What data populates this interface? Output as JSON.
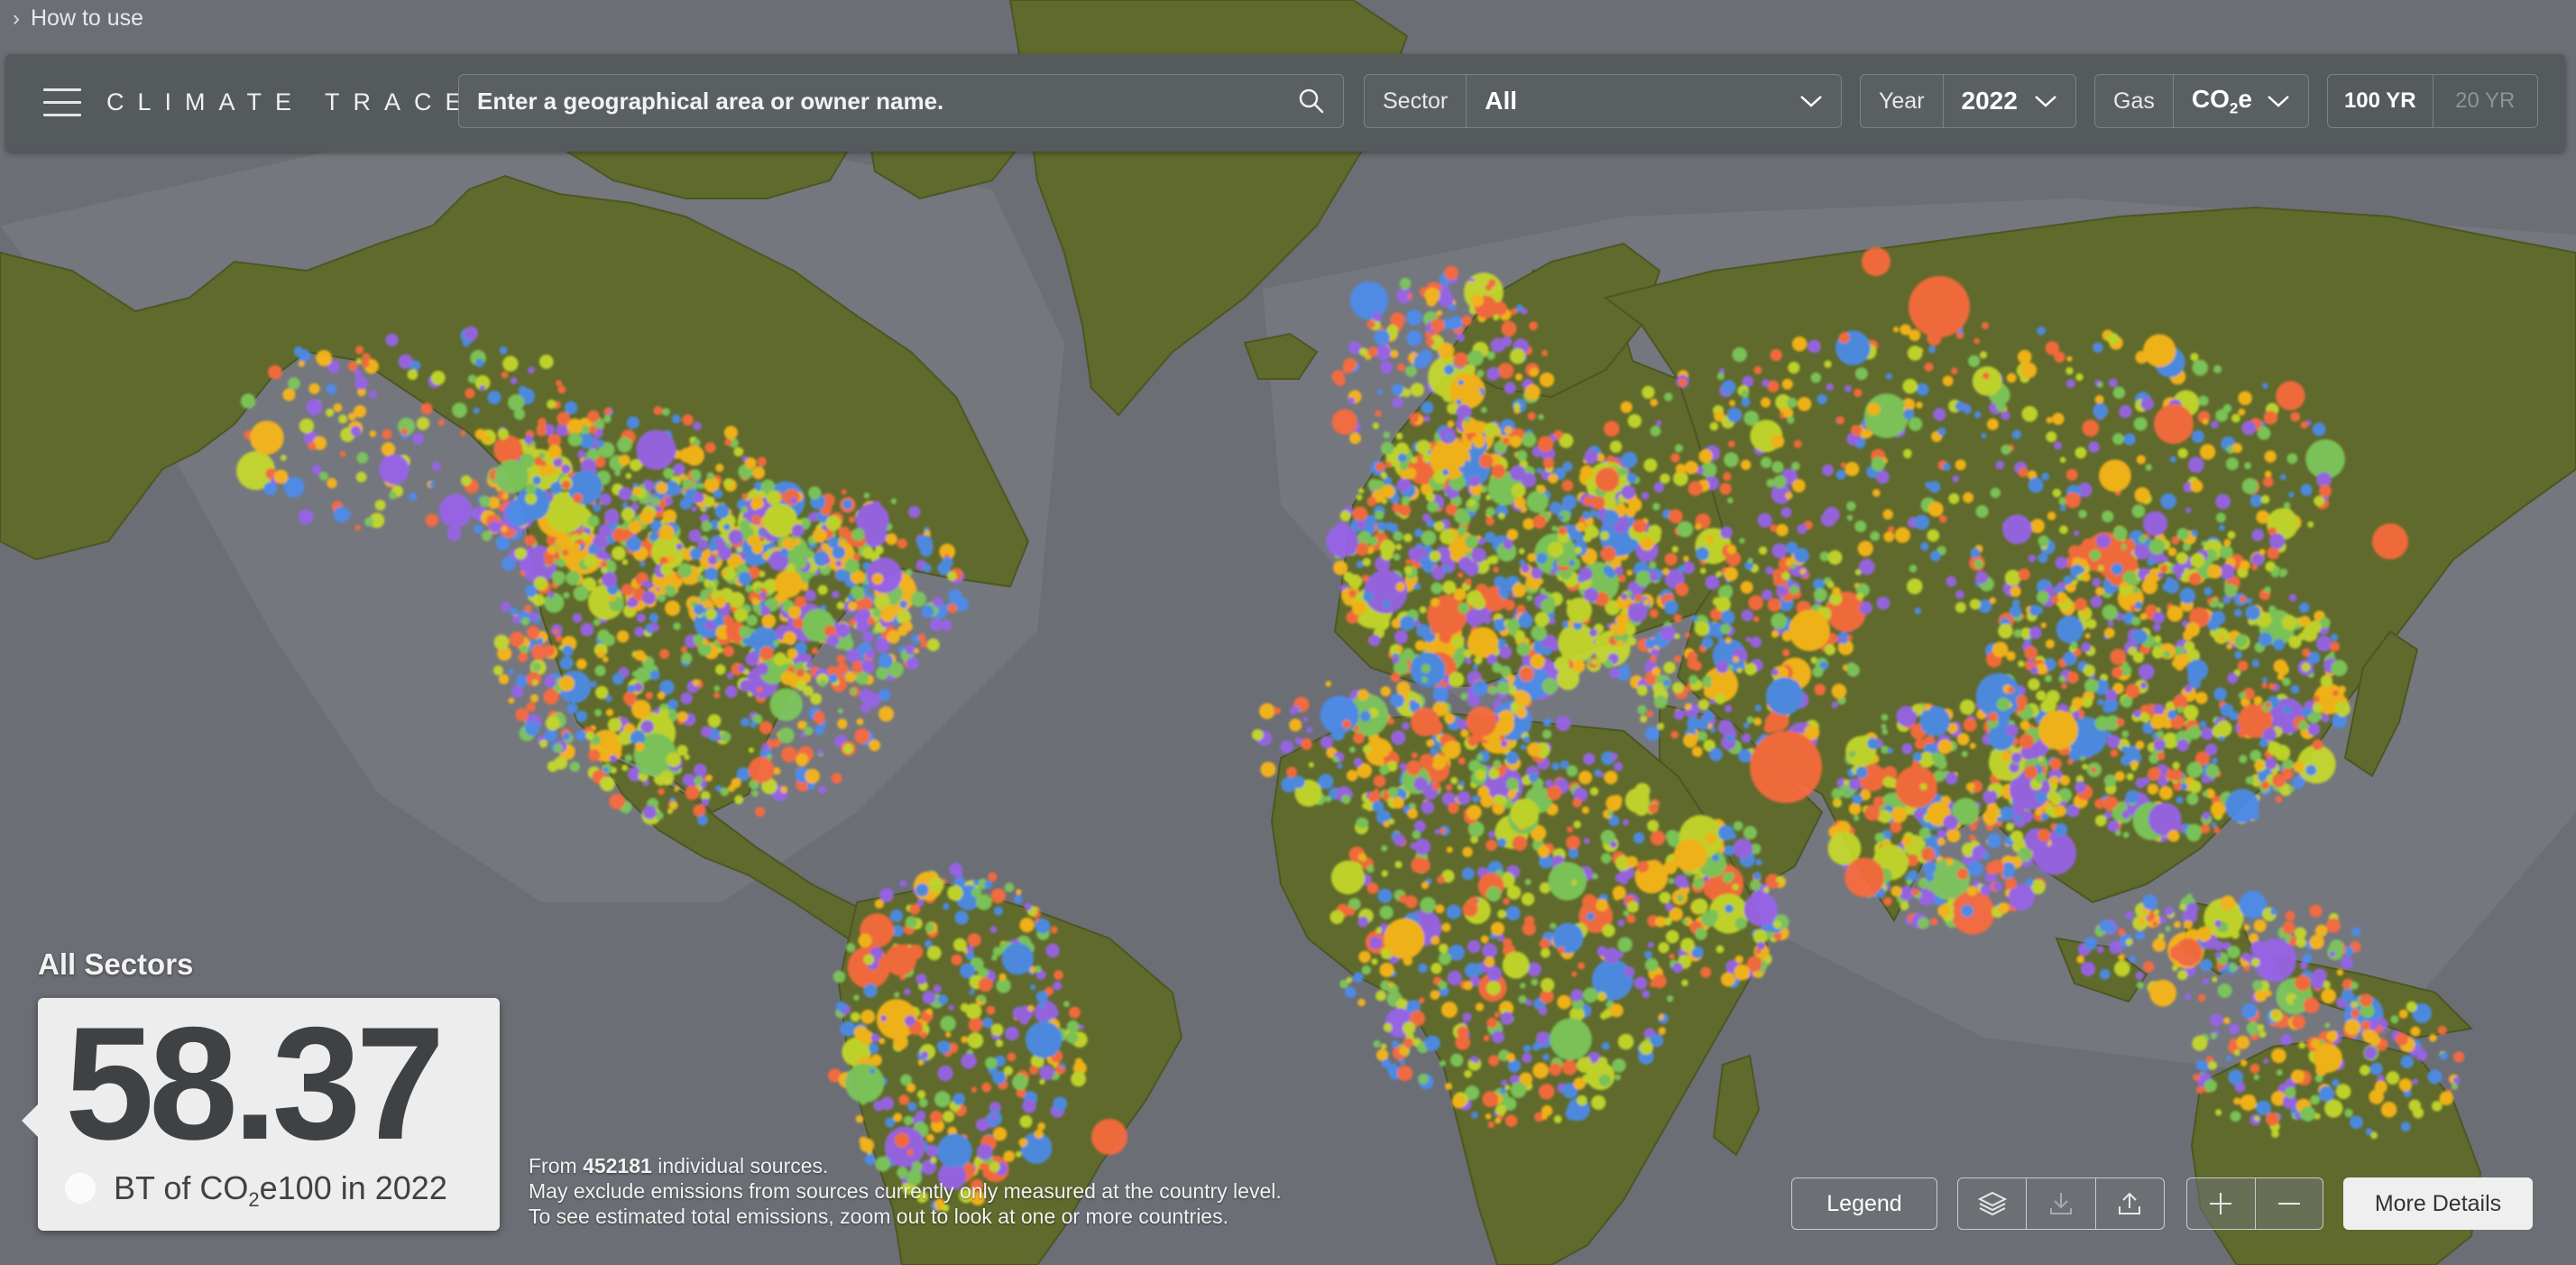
{
  "help": {
    "label": "How to use"
  },
  "header": {
    "logo": "CLIMATE TRACE",
    "search_placeholder": "Enter a geographical area or owner name.",
    "sector_label": "Sector",
    "sector_value": "All",
    "year_label": "Year",
    "year_value": "2022",
    "gas_label": "Gas",
    "gas_value_main": "CO",
    "gas_value_sub": "2",
    "gas_value_tail": "e",
    "gwp_options": [
      "100 YR",
      "20 YR"
    ],
    "gwp_selected": "100 YR"
  },
  "summary": {
    "title": "All Sectors",
    "total": "58.37",
    "unit_prefix": "BT of CO",
    "unit_sub": "2",
    "unit_suffix": "e100 in 2022"
  },
  "info": {
    "sources_prefix": "From ",
    "sources_count": "452181",
    "sources_suffix": " individual sources.",
    "line2": "May exclude emissions from sources currently only measured at the country level.",
    "line3": "To see estimated total emissions, zoom out to look at one or more countries."
  },
  "controls": {
    "legend": "Legend",
    "more_details": "More Details"
  },
  "colors": {
    "ocean": "#6b6e74",
    "land": "#5f6a2c",
    "toolbar": "#555a5d",
    "emission_colors": [
      "#ffb914",
      "#c9dd2b",
      "#ff6a3c",
      "#9a63ef",
      "#4c8df0",
      "#7ecb5c"
    ]
  }
}
